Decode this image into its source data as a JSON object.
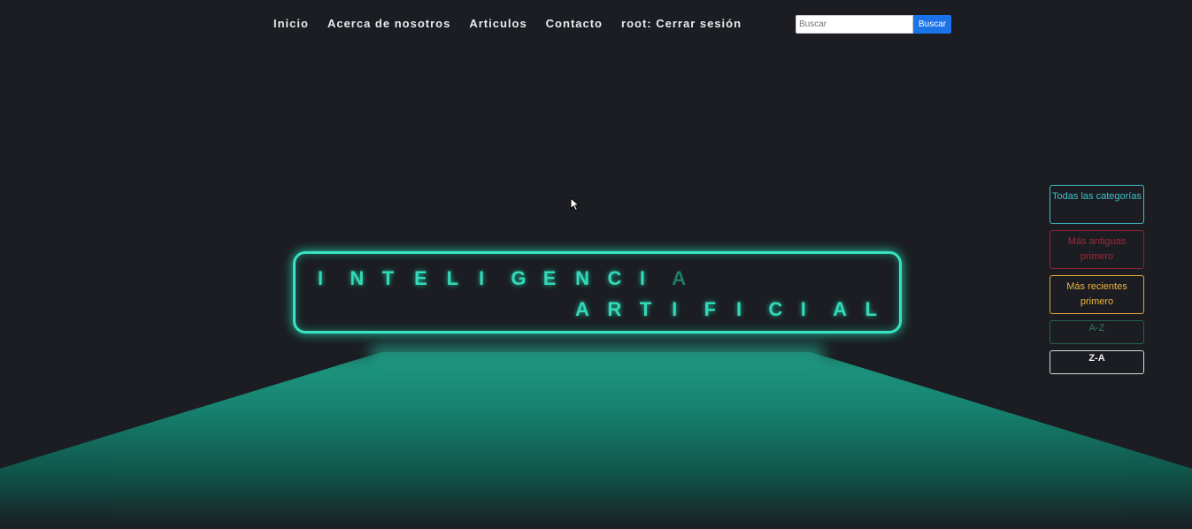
{
  "nav": {
    "items": [
      "Inicio",
      "Acerca de nosotros",
      "Articulos",
      "Contacto",
      "root: Cerrar sesión"
    ]
  },
  "search": {
    "placeholder": "Buscar",
    "button_label": "Buscar"
  },
  "hero": {
    "line1": [
      "I",
      "N",
      "T",
      "E",
      "L",
      "I",
      "G",
      "E",
      "N",
      "C",
      "I",
      "A"
    ],
    "line2": [
      "A",
      "R",
      "T",
      "I",
      "F",
      "I",
      "C",
      "I",
      "A",
      "L"
    ]
  },
  "filters": {
    "all_categories": "Todas las categorías",
    "oldest_first": "Más antiguas primero",
    "newest_first": "Más recientes primero",
    "az": "A-Z",
    "za": "Z-A"
  },
  "colors": {
    "background": "#1b1d22",
    "neon": "#38e3c2",
    "search_button": "#1a73e8"
  }
}
